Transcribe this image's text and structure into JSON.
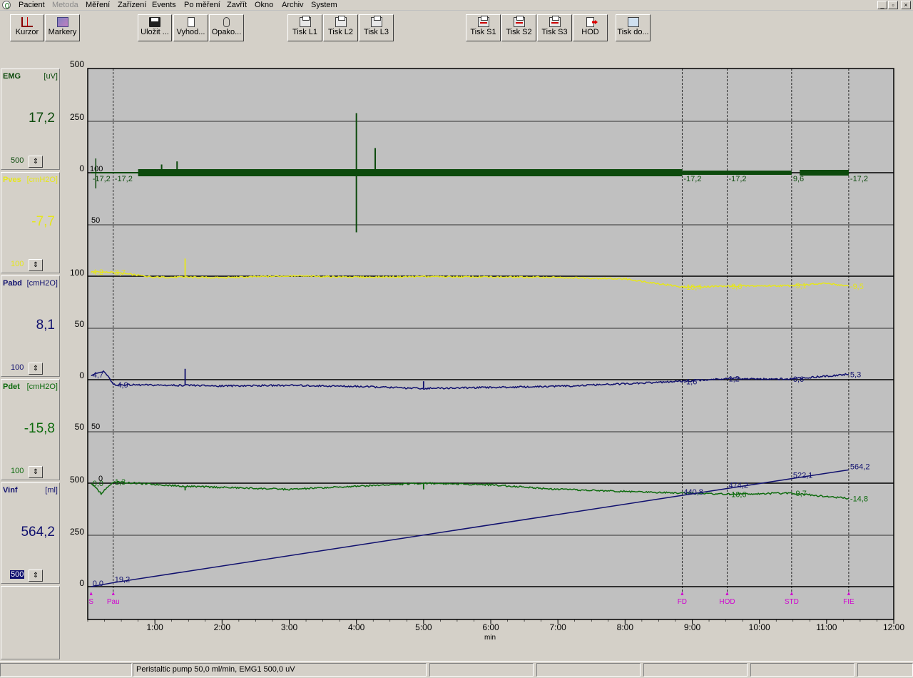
{
  "menu": {
    "items": [
      {
        "label": "Pacient",
        "enabled": true
      },
      {
        "label": "Metoda",
        "enabled": false
      },
      {
        "label": "Měření",
        "enabled": true
      },
      {
        "label": "Zařízení",
        "enabled": true
      },
      {
        "label": "Events",
        "enabled": true
      },
      {
        "label": "Po měření",
        "enabled": true
      },
      {
        "label": "Zavřít",
        "enabled": true
      },
      {
        "label": "Okno",
        "enabled": true
      },
      {
        "label": "Archiv",
        "enabled": true
      },
      {
        "label": "System",
        "enabled": true
      }
    ],
    "window_buttons": [
      "_",
      "▫",
      "×"
    ]
  },
  "toolbar": {
    "buttons": [
      {
        "label": "Kurzor",
        "icon": "cursor-icon"
      },
      {
        "label": "Markery",
        "icon": "marker-icon"
      },
      {
        "label": "Uložit ...",
        "icon": "save-icon"
      },
      {
        "label": "Vyhod...",
        "icon": "calculator-icon"
      },
      {
        "label": "Opako...",
        "icon": "mouse-icon"
      },
      {
        "label": "Tisk L1",
        "icon": "printer-icon"
      },
      {
        "label": "Tisk L2",
        "icon": "printer-icon"
      },
      {
        "label": "Tisk L3",
        "icon": "printer-icon"
      },
      {
        "label": "Tisk S1",
        "icon": "printer-red-icon"
      },
      {
        "label": "Tisk S2",
        "icon": "printer-red-icon"
      },
      {
        "label": "Tisk S3",
        "icon": "printer-red-icon"
      },
      {
        "label": "HOD",
        "icon": "exit-icon"
      },
      {
        "label": "Tisk do...",
        "icon": "print-document-icon"
      }
    ]
  },
  "channels": [
    {
      "name": "EMG",
      "unit": "[uV]",
      "value": "17,2",
      "range": "500",
      "color": "#0c4a0c",
      "highlight": false
    },
    {
      "name": "Pves",
      "unit": "[cmH2O]",
      "value": "-7,7",
      "range": "100",
      "color": "#e6e61a",
      "highlight": false
    },
    {
      "name": "Pabd",
      "unit": "[cmH2O]",
      "value": "8,1",
      "range": "100",
      "color": "#10106e",
      "highlight": false
    },
    {
      "name": "Pdet",
      "unit": "[cmH2O]",
      "value": "-15,8",
      "range": "100",
      "color": "#0c6a0c",
      "highlight": false
    },
    {
      "name": "Vinf",
      "unit": "[ml]",
      "value": "564,2",
      "range": "500",
      "color": "#10106e",
      "highlight": true
    }
  ],
  "chart_data": {
    "type": "line",
    "xlabel": "min",
    "x_range_min": [
      0,
      12
    ],
    "x_ticks": [
      "1:00",
      "2:00",
      "3:00",
      "4:00",
      "5:00",
      "6:00",
      "7:00",
      "8:00",
      "9:00",
      "10:00",
      "11:00",
      "12:00"
    ],
    "y_axis_labels": {
      "emg": [
        "500",
        "250",
        "0"
      ],
      "pves": [
        "100",
        "50"
      ],
      "pabd": [
        "50",
        "0"
      ],
      "pdet": [
        "50",
        "0"
      ],
      "vinf": [
        "500",
        "250",
        "0"
      ]
    },
    "overlay_labels": {
      "emg_top": "100",
      "pves_top": "50",
      "pabd_top": "50",
      "pdet_top": "0"
    },
    "markers": [
      {
        "label": "S",
        "t": 0.05
      },
      {
        "label": "Pau",
        "t": 0.38
      },
      {
        "label": "FD",
        "t": 8.85
      },
      {
        "label": "HOD",
        "t": 9.52
      },
      {
        "label": "STD",
        "t": 10.48
      },
      {
        "label": "FIE",
        "t": 11.33
      }
    ],
    "series": [
      {
        "name": "EMG",
        "color": "#0c4a0c",
        "points": [
          [
            0.05,
            0
          ],
          [
            0.38,
            0
          ],
          [
            8.85,
            0
          ],
          [
            9.52,
            0
          ],
          [
            10.48,
            0
          ],
          [
            11.33,
            0
          ]
        ],
        "labels": [
          "-17,2",
          "-17,2",
          "-17,2",
          "-17,2",
          "9,6",
          "-17,2"
        ],
        "spikes": [
          [
            1.1,
            40
          ],
          [
            1.33,
            55
          ],
          [
            4.0,
            -290
          ],
          [
            4.0,
            290
          ],
          [
            4.28,
            120
          ]
        ]
      },
      {
        "name": "Pves",
        "color": "#e6e61a",
        "points": [
          [
            0.05,
            4.2
          ],
          [
            0.38,
            3.7
          ],
          [
            1.0,
            -1
          ],
          [
            1.45,
            -1
          ],
          [
            2.0,
            -1.5
          ],
          [
            3.0,
            0.3
          ],
          [
            4.0,
            -1.0
          ],
          [
            5.0,
            -0.5
          ],
          [
            6.0,
            -0.8
          ],
          [
            7.0,
            -1.2
          ],
          [
            8.0,
            -2.5
          ],
          [
            8.85,
            -10.4
          ],
          [
            9.52,
            -9.6
          ],
          [
            10.48,
            -9.1
          ],
          [
            11.0,
            -7.0
          ],
          [
            11.33,
            -9.5
          ]
        ],
        "labels": [
          "4,2",
          "3,7",
          "-10,4",
          "-9,6",
          "-9,1",
          "-9,5"
        ],
        "spikes": [
          [
            1.45,
            18
          ]
        ]
      },
      {
        "name": "Pabd",
        "color": "#10106e",
        "points": [
          [
            0.05,
            4.7
          ],
          [
            0.25,
            8
          ],
          [
            0.38,
            -4.9
          ],
          [
            1.45,
            -5.5
          ],
          [
            2.0,
            -6
          ],
          [
            3.0,
            -5.5
          ],
          [
            4.0,
            -6.5
          ],
          [
            5.0,
            -8.5
          ],
          [
            6.0,
            -7.5
          ],
          [
            7.0,
            -6.5
          ],
          [
            8.0,
            -4
          ],
          [
            8.85,
            -1.6
          ],
          [
            9.52,
            1.2
          ],
          [
            10.48,
            0.6
          ],
          [
            11.33,
            5.3
          ]
        ],
        "labels": [
          "4,7",
          "-4,9",
          "-1,6",
          "1,2",
          "0,6",
          "5,3"
        ],
        "spikes": [
          [
            1.45,
            16
          ],
          [
            5.0,
            7
          ]
        ]
      },
      {
        "name": "Pdet",
        "color": "#0c6a0c",
        "points": [
          [
            0.05,
            0
          ],
          [
            0.2,
            -10
          ],
          [
            0.38,
            1.3
          ],
          [
            1.45,
            -3
          ],
          [
            3.0,
            -6
          ],
          [
            4.0,
            -3
          ],
          [
            5.0,
            0
          ],
          [
            6.0,
            -1.5
          ],
          [
            7.0,
            -6
          ],
          [
            8.0,
            -8
          ],
          [
            8.85,
            -9.5
          ],
          [
            9.52,
            -10.6
          ],
          [
            10.48,
            -9.7
          ],
          [
            11.33,
            -14.8
          ]
        ],
        "labels": [
          "0,0",
          "1,3",
          "",
          "-10,6",
          "-9,7",
          "-14,8"
        ],
        "spikes": [
          [
            5.0,
            -6
          ],
          [
            1.45,
            -4
          ]
        ]
      },
      {
        "name": "Vinf",
        "color": "#10106e",
        "points": [
          [
            0.05,
            0
          ],
          [
            0.38,
            19.2
          ],
          [
            8.85,
            440.8
          ],
          [
            9.52,
            474.2
          ],
          [
            10.48,
            522.1
          ],
          [
            11.33,
            564.2
          ]
        ],
        "labels": [
          "0,0",
          "19,2",
          "440,8",
          "474,2",
          "522,1",
          "564,2"
        ]
      }
    ]
  },
  "status": {
    "message": "Peristaltic pump 50,0 ml/min,  EMG1 500,0 uV"
  }
}
